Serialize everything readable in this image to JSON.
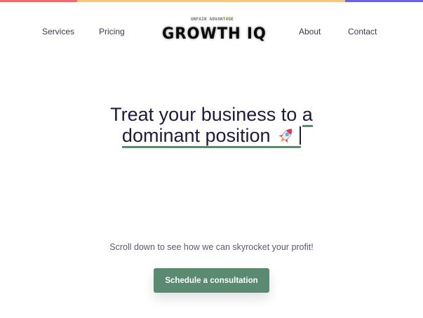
{
  "colors": {
    "bar_left": "#f06a6a",
    "bar_middle": "#f7c780",
    "bar_right": "#6c63e0",
    "accent": "#5b8a72",
    "text": "#1e1b3a"
  },
  "nav": {
    "links": [
      "Services",
      "Pricing",
      "About",
      "Contact"
    ]
  },
  "logo": {
    "tagline": "UNFAIR ADVANTAGE",
    "name": "GROWTH IQ",
    "spark_icon": "sparkle-icon"
  },
  "hero": {
    "line1_prefix": "Treat your business to ",
    "line1_highlight": "a",
    "line2": "dominant position",
    "rocket_icon": "rocket-icon"
  },
  "subtext": "Scroll down to see how we can skyrocket your profit!",
  "cta": {
    "label": "Schedule a consultation"
  }
}
